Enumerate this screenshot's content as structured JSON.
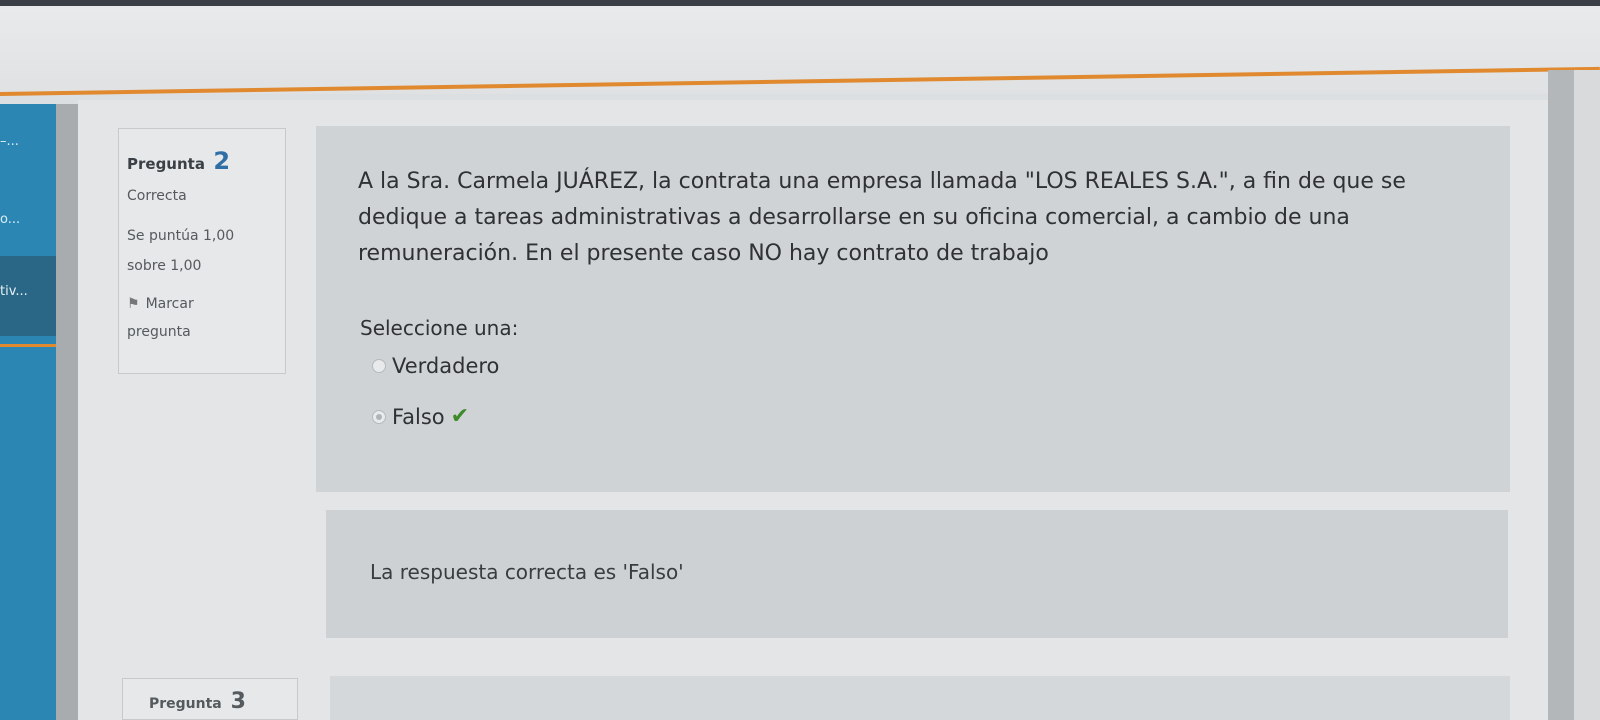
{
  "sidebar": {
    "items": [
      {
        "label": "–..."
      },
      {
        "label": "o..."
      },
      {
        "label": "tiv..."
      }
    ]
  },
  "question": {
    "label": "Pregunta",
    "number": "2",
    "status": "Correcta",
    "score_line1": "Se puntúa 1,00",
    "score_line2": "sobre 1,00",
    "flag_label_line1": "Marcar",
    "flag_label_line2": "pregunta",
    "text": "A la Sra. Carmela JUÁREZ, la contrata una empresa llamada \"LOS REALES S.A.\", a fin de que se dedique a tareas administrativas a desarrollarse en su oficina comercial, a cambio de una remuneración. En el presente caso NO hay contrato de trabajo",
    "prompt": "Seleccione una:",
    "options": [
      {
        "label": "Verdadero",
        "selected": false,
        "correct": false
      },
      {
        "label": "Falso",
        "selected": true,
        "correct": true
      }
    ],
    "feedback": "La respuesta correcta es 'Falso'"
  },
  "next_question": {
    "label": "Pregunta",
    "number": "3"
  },
  "colors": {
    "accent_orange": "#e0892f",
    "sidebar_blue": "#2c86b3",
    "check_green": "#3c8a2a"
  }
}
